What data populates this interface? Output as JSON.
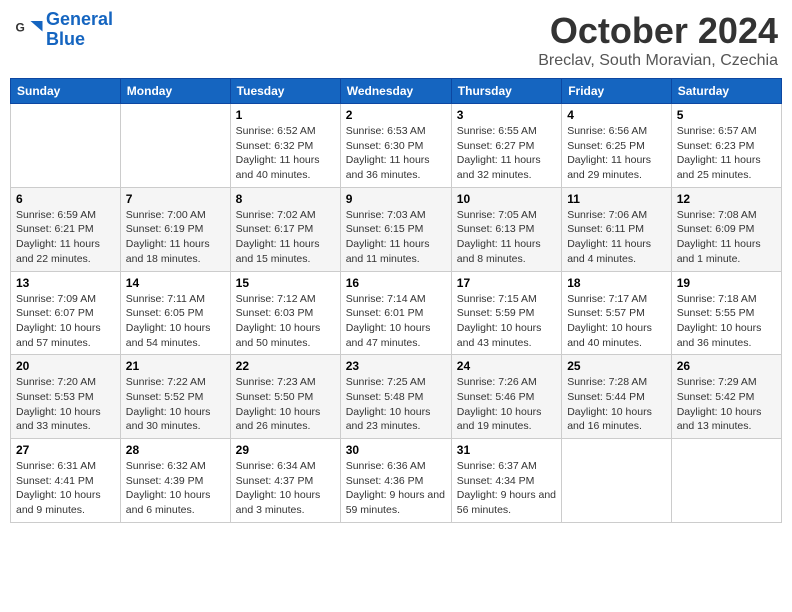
{
  "header": {
    "logo_line1": "General",
    "logo_line2": "Blue",
    "month_title": "October 2024",
    "location": "Breclav, South Moravian, Czechia"
  },
  "days_of_week": [
    "Sunday",
    "Monday",
    "Tuesday",
    "Wednesday",
    "Thursday",
    "Friday",
    "Saturday"
  ],
  "weeks": [
    [
      {
        "day": "",
        "info": ""
      },
      {
        "day": "",
        "info": ""
      },
      {
        "day": "1",
        "info": "Sunrise: 6:52 AM\nSunset: 6:32 PM\nDaylight: 11 hours and 40 minutes."
      },
      {
        "day": "2",
        "info": "Sunrise: 6:53 AM\nSunset: 6:30 PM\nDaylight: 11 hours and 36 minutes."
      },
      {
        "day": "3",
        "info": "Sunrise: 6:55 AM\nSunset: 6:27 PM\nDaylight: 11 hours and 32 minutes."
      },
      {
        "day": "4",
        "info": "Sunrise: 6:56 AM\nSunset: 6:25 PM\nDaylight: 11 hours and 29 minutes."
      },
      {
        "day": "5",
        "info": "Sunrise: 6:57 AM\nSunset: 6:23 PM\nDaylight: 11 hours and 25 minutes."
      }
    ],
    [
      {
        "day": "6",
        "info": "Sunrise: 6:59 AM\nSunset: 6:21 PM\nDaylight: 11 hours and 22 minutes."
      },
      {
        "day": "7",
        "info": "Sunrise: 7:00 AM\nSunset: 6:19 PM\nDaylight: 11 hours and 18 minutes."
      },
      {
        "day": "8",
        "info": "Sunrise: 7:02 AM\nSunset: 6:17 PM\nDaylight: 11 hours and 15 minutes."
      },
      {
        "day": "9",
        "info": "Sunrise: 7:03 AM\nSunset: 6:15 PM\nDaylight: 11 hours and 11 minutes."
      },
      {
        "day": "10",
        "info": "Sunrise: 7:05 AM\nSunset: 6:13 PM\nDaylight: 11 hours and 8 minutes."
      },
      {
        "day": "11",
        "info": "Sunrise: 7:06 AM\nSunset: 6:11 PM\nDaylight: 11 hours and 4 minutes."
      },
      {
        "day": "12",
        "info": "Sunrise: 7:08 AM\nSunset: 6:09 PM\nDaylight: 11 hours and 1 minute."
      }
    ],
    [
      {
        "day": "13",
        "info": "Sunrise: 7:09 AM\nSunset: 6:07 PM\nDaylight: 10 hours and 57 minutes."
      },
      {
        "day": "14",
        "info": "Sunrise: 7:11 AM\nSunset: 6:05 PM\nDaylight: 10 hours and 54 minutes."
      },
      {
        "day": "15",
        "info": "Sunrise: 7:12 AM\nSunset: 6:03 PM\nDaylight: 10 hours and 50 minutes."
      },
      {
        "day": "16",
        "info": "Sunrise: 7:14 AM\nSunset: 6:01 PM\nDaylight: 10 hours and 47 minutes."
      },
      {
        "day": "17",
        "info": "Sunrise: 7:15 AM\nSunset: 5:59 PM\nDaylight: 10 hours and 43 minutes."
      },
      {
        "day": "18",
        "info": "Sunrise: 7:17 AM\nSunset: 5:57 PM\nDaylight: 10 hours and 40 minutes."
      },
      {
        "day": "19",
        "info": "Sunrise: 7:18 AM\nSunset: 5:55 PM\nDaylight: 10 hours and 36 minutes."
      }
    ],
    [
      {
        "day": "20",
        "info": "Sunrise: 7:20 AM\nSunset: 5:53 PM\nDaylight: 10 hours and 33 minutes."
      },
      {
        "day": "21",
        "info": "Sunrise: 7:22 AM\nSunset: 5:52 PM\nDaylight: 10 hours and 30 minutes."
      },
      {
        "day": "22",
        "info": "Sunrise: 7:23 AM\nSunset: 5:50 PM\nDaylight: 10 hours and 26 minutes."
      },
      {
        "day": "23",
        "info": "Sunrise: 7:25 AM\nSunset: 5:48 PM\nDaylight: 10 hours and 23 minutes."
      },
      {
        "day": "24",
        "info": "Sunrise: 7:26 AM\nSunset: 5:46 PM\nDaylight: 10 hours and 19 minutes."
      },
      {
        "day": "25",
        "info": "Sunrise: 7:28 AM\nSunset: 5:44 PM\nDaylight: 10 hours and 16 minutes."
      },
      {
        "day": "26",
        "info": "Sunrise: 7:29 AM\nSunset: 5:42 PM\nDaylight: 10 hours and 13 minutes."
      }
    ],
    [
      {
        "day": "27",
        "info": "Sunrise: 6:31 AM\nSunset: 4:41 PM\nDaylight: 10 hours and 9 minutes."
      },
      {
        "day": "28",
        "info": "Sunrise: 6:32 AM\nSunset: 4:39 PM\nDaylight: 10 hours and 6 minutes."
      },
      {
        "day": "29",
        "info": "Sunrise: 6:34 AM\nSunset: 4:37 PM\nDaylight: 10 hours and 3 minutes."
      },
      {
        "day": "30",
        "info": "Sunrise: 6:36 AM\nSunset: 4:36 PM\nDaylight: 9 hours and 59 minutes."
      },
      {
        "day": "31",
        "info": "Sunrise: 6:37 AM\nSunset: 4:34 PM\nDaylight: 9 hours and 56 minutes."
      },
      {
        "day": "",
        "info": ""
      },
      {
        "day": "",
        "info": ""
      }
    ]
  ]
}
